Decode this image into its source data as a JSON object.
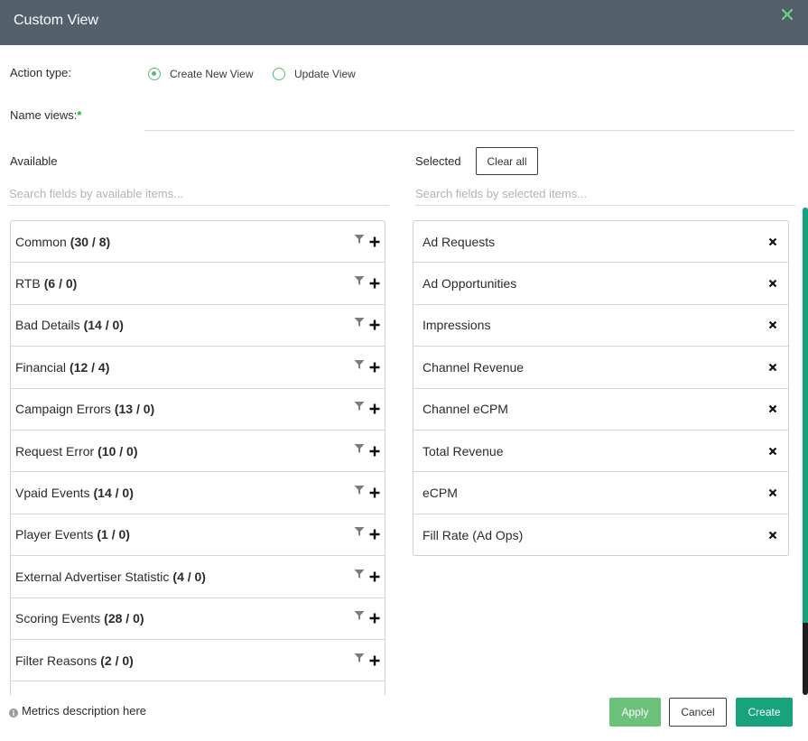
{
  "header": {
    "title": "Custom View",
    "close_icon": "close-icon"
  },
  "action_type": {
    "label": "Action type:",
    "options": [
      {
        "label": "Create New View",
        "checked": true
      },
      {
        "label": "Update View",
        "checked": false
      }
    ]
  },
  "name_views": {
    "label": "Name views:",
    "required_mark": "*",
    "value": "",
    "placeholder": ""
  },
  "available": {
    "label": "Available",
    "search_placeholder": "Search fields by available items...",
    "items": [
      {
        "name": "Common",
        "count": "(30 / 8)"
      },
      {
        "name": "RTB",
        "count": "(6 / 0)"
      },
      {
        "name": "Bad Details",
        "count": "(14 / 0)"
      },
      {
        "name": "Financial",
        "count": "(12 / 4)"
      },
      {
        "name": "Campaign Errors",
        "count": "(13 / 0)"
      },
      {
        "name": "Request Error",
        "count": "(10 / 0)"
      },
      {
        "name": "Vpaid Events",
        "count": "(14 / 0)"
      },
      {
        "name": "Player Events",
        "count": "(1 / 0)"
      },
      {
        "name": "External Advertiser Statistic",
        "count": "(4 / 0)"
      },
      {
        "name": "Scoring Events",
        "count": "(28 / 0)"
      },
      {
        "name": "Filter Reasons",
        "count": "(2 / 0)"
      }
    ]
  },
  "selected": {
    "label": "Selected",
    "clear_all_label": "Clear all",
    "search_placeholder": "Search fields by selected items...",
    "items": [
      "Ad Requests",
      "Ad Opportunities",
      "Impressions",
      "Channel Revenue",
      "Channel eCPM",
      "Total Revenue",
      "eCPM",
      "Fill Rate (Ad Ops)"
    ]
  },
  "footer": {
    "metrics_link": "Metrics description here",
    "apply_label": "Apply",
    "cancel_label": "Cancel",
    "create_label": "Create"
  },
  "colors": {
    "header_bg": "#545f6c",
    "accent_green": "#17a37c",
    "apply_green": "#6cc17a",
    "radio_green": "#5cb874"
  }
}
